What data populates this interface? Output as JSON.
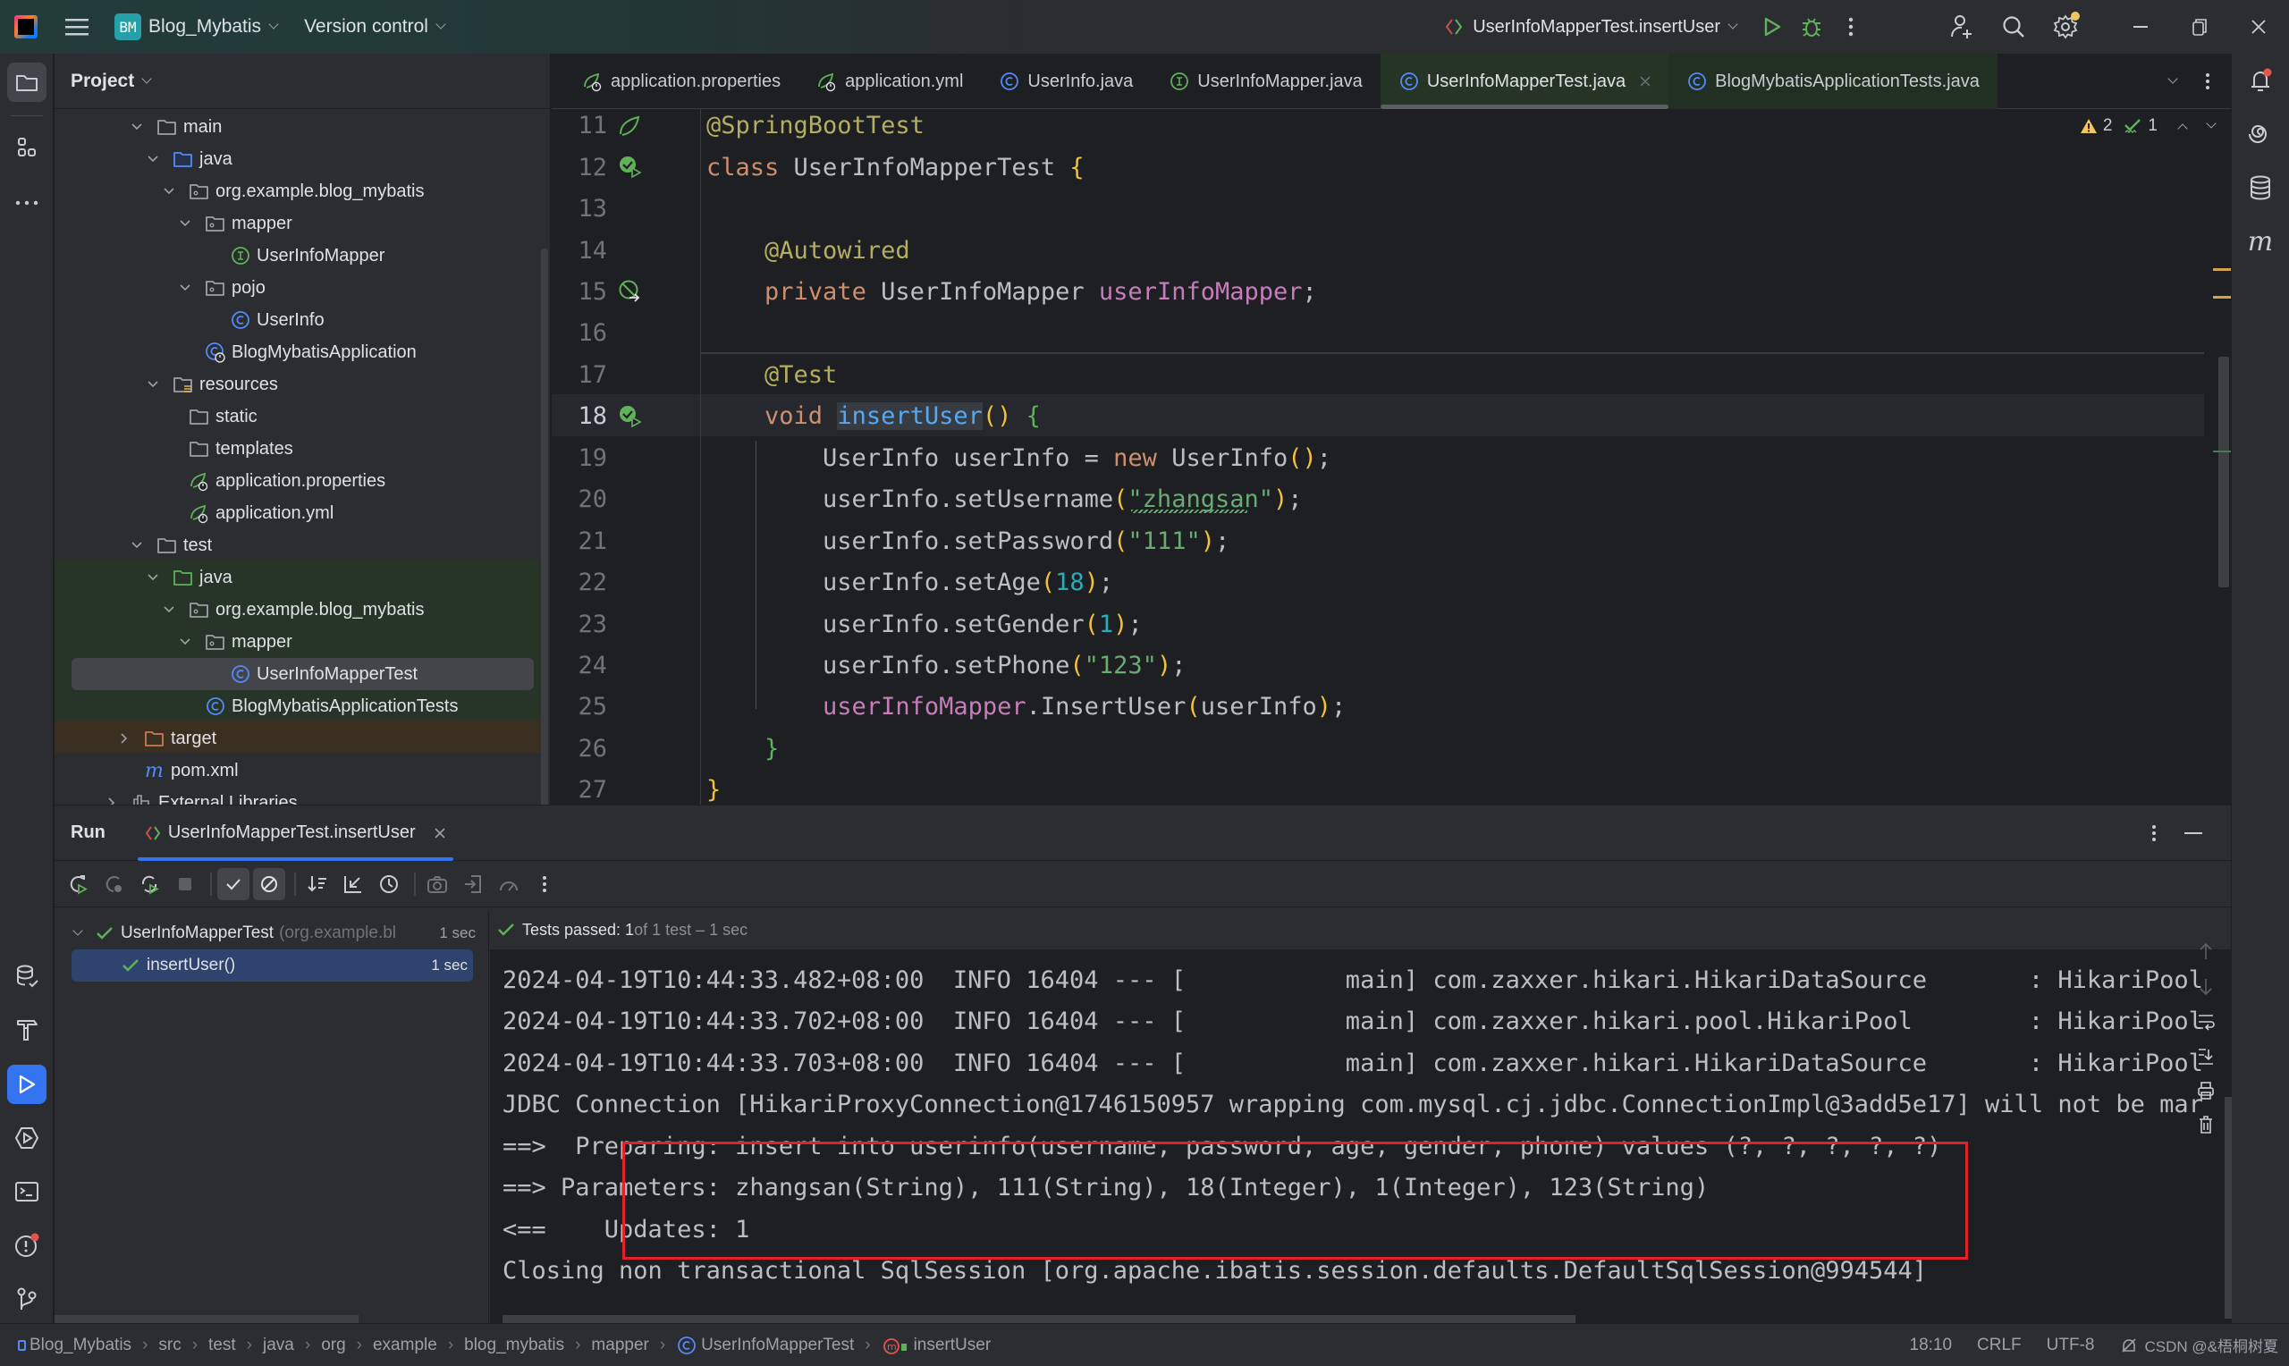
{
  "titlebar": {
    "project_badge": "BM",
    "project_name": "Blog_Mybatis",
    "vcs_label": "Version control",
    "run_config": "UserInfoMapperTest.insertUser"
  },
  "project_panel": {
    "title": "Project",
    "tree": [
      {
        "label": "main",
        "icon": "folder-icon",
        "depth": 0,
        "expanded": true
      },
      {
        "label": "java",
        "icon": "source-folder-icon",
        "depth": 1,
        "expanded": true
      },
      {
        "label": "org.example.blog_mybatis",
        "icon": "package-icon",
        "depth": 2,
        "expanded": true
      },
      {
        "label": "mapper",
        "icon": "package-icon",
        "depth": 3,
        "expanded": true
      },
      {
        "label": "UserInfoMapper",
        "icon": "interface-icon",
        "depth": 4
      },
      {
        "label": "pojo",
        "icon": "package-icon",
        "depth": 3,
        "expanded": true
      },
      {
        "label": "UserInfo",
        "icon": "class-icon",
        "depth": 4
      },
      {
        "label": "BlogMybatisApplication",
        "icon": "spring-boot-class-icon",
        "depth": 3
      },
      {
        "label": "resources",
        "icon": "resources-folder-icon",
        "depth": 1,
        "expanded": true
      },
      {
        "label": "static",
        "icon": "folder-icon",
        "depth": 2
      },
      {
        "label": "templates",
        "icon": "folder-icon",
        "depth": 2
      },
      {
        "label": "application.properties",
        "icon": "spring-config-icon",
        "depth": 2
      },
      {
        "label": "application.yml",
        "icon": "spring-config-icon",
        "depth": 2
      },
      {
        "label": "test",
        "icon": "folder-icon",
        "depth": 0,
        "expanded": true
      },
      {
        "label": "java",
        "icon": "test-folder-icon",
        "depth": 1,
        "expanded": true
      },
      {
        "label": "org.example.blog_mybatis",
        "icon": "package-icon",
        "depth": 2,
        "expanded": true
      },
      {
        "label": "mapper",
        "icon": "package-icon",
        "depth": 3,
        "expanded": true
      },
      {
        "label": "UserInfoMapperTest",
        "icon": "class-icon",
        "depth": 4,
        "selected": true
      },
      {
        "label": "BlogMybatisApplicationTests",
        "icon": "class-icon",
        "depth": 3
      },
      {
        "label": "target",
        "icon": "excluded-folder-icon",
        "depth": -1,
        "expanded": false
      },
      {
        "label": "pom.xml",
        "icon": "maven-icon",
        "depth": -1
      },
      {
        "label": "External Libraries",
        "icon": "library-icon",
        "depth": -2,
        "expanded": false
      }
    ]
  },
  "tabs": [
    {
      "label": "application.properties",
      "icon": "spring-config-icon"
    },
    {
      "label": "application.yml",
      "icon": "spring-config-icon"
    },
    {
      "label": "UserInfo.java",
      "icon": "class-icon"
    },
    {
      "label": "UserInfoMapper.java",
      "icon": "interface-icon"
    },
    {
      "label": "UserInfoMapperTest.java",
      "icon": "class-icon",
      "active": true
    },
    {
      "label": "BlogMybatisApplicationTests.java",
      "icon": "class-icon"
    }
  ],
  "editor": {
    "warnings": "2",
    "typos": "1",
    "current_line": 18,
    "lines": [
      {
        "n": "11",
        "tokens": [
          [
            "an",
            "@SpringBootTest"
          ]
        ]
      },
      {
        "n": "12",
        "tokens": [
          [
            "k",
            "class "
          ],
          [
            "pl",
            "UserInfoMapperTest "
          ],
          [
            "br",
            "{"
          ]
        ]
      },
      {
        "n": "13",
        "tokens": []
      },
      {
        "n": "14",
        "tokens": [
          [
            "pl",
            "    "
          ],
          [
            "an",
            "@Autowired"
          ]
        ]
      },
      {
        "n": "15",
        "tokens": [
          [
            "pl",
            "    "
          ],
          [
            "k",
            "private "
          ],
          [
            "pl",
            "UserInfoMapper "
          ],
          [
            "fld",
            "userInfoMapper"
          ],
          [
            "pl",
            ";"
          ]
        ]
      },
      {
        "n": "16",
        "tokens": []
      },
      {
        "n": "17",
        "tokens": [
          [
            "pl",
            "    "
          ],
          [
            "an",
            "@Test"
          ]
        ]
      },
      {
        "n": "18",
        "tokens": [
          [
            "pl",
            "    "
          ],
          [
            "k",
            "void "
          ],
          [
            "mth",
            "insertUser"
          ],
          [
            "br",
            "()"
          ],
          [
            "pl",
            " "
          ],
          [
            "bg",
            "{"
          ]
        ]
      },
      {
        "n": "19",
        "tokens": [
          [
            "pl",
            "        UserInfo userInfo = "
          ],
          [
            "k",
            "new "
          ],
          [
            "pl",
            "UserInfo"
          ],
          [
            "br",
            "()"
          ],
          [
            "pl",
            ";"
          ]
        ]
      },
      {
        "n": "20",
        "tokens": [
          [
            "pl",
            "        userInfo.setUsername"
          ],
          [
            "br",
            "("
          ],
          [
            "st",
            "\"zhangsan\""
          ],
          [
            "br",
            ")"
          ],
          [
            "pl",
            ";"
          ]
        ]
      },
      {
        "n": "21",
        "tokens": [
          [
            "pl",
            "        userInfo.setPassword"
          ],
          [
            "br",
            "("
          ],
          [
            "st",
            "\"111\""
          ],
          [
            "br",
            ")"
          ],
          [
            "pl",
            ";"
          ]
        ]
      },
      {
        "n": "22",
        "tokens": [
          [
            "pl",
            "        userInfo.setAge"
          ],
          [
            "br",
            "("
          ],
          [
            "num",
            "18"
          ],
          [
            "br",
            ")"
          ],
          [
            "pl",
            ";"
          ]
        ]
      },
      {
        "n": "23",
        "tokens": [
          [
            "pl",
            "        userInfo.setGender"
          ],
          [
            "br",
            "("
          ],
          [
            "num",
            "1"
          ],
          [
            "br",
            ")"
          ],
          [
            "pl",
            ";"
          ]
        ]
      },
      {
        "n": "24",
        "tokens": [
          [
            "pl",
            "        userInfo.setPhone"
          ],
          [
            "br",
            "("
          ],
          [
            "st",
            "\"123\""
          ],
          [
            "br",
            ")"
          ],
          [
            "pl",
            ";"
          ]
        ]
      },
      {
        "n": "25",
        "tokens": [
          [
            "pl",
            "        "
          ],
          [
            "fld",
            "userInfoMapper"
          ],
          [
            "pl",
            ".InsertUser"
          ],
          [
            "br",
            "("
          ],
          [
            "pl",
            "userInfo"
          ],
          [
            "br",
            ")"
          ],
          [
            "pl",
            ";"
          ]
        ]
      },
      {
        "n": "26",
        "tokens": [
          [
            "pl",
            "    "
          ],
          [
            "bg",
            "}"
          ]
        ]
      },
      {
        "n": "27",
        "tokens": [
          [
            "br",
            "}"
          ]
        ]
      }
    ]
  },
  "run_panel": {
    "title": "Run",
    "tab_label": "UserInfoMapperTest.insertUser",
    "tests": [
      {
        "label": "UserInfoMapperTest",
        "detail": "(org.example.bl",
        "time": "1 sec",
        "status": "passed"
      },
      {
        "label": "insertUser()",
        "time": "1 sec",
        "status": "passed",
        "selected": true
      }
    ],
    "summary_bold": "Tests passed: 1",
    "summary_rest": " of 1 test – 1 sec",
    "console": [
      "2024-04-19T10:44:33.482+08:00  INFO 16404 --- [           main] com.zaxxer.hikari.HikariDataSource       : HikariPool",
      "2024-04-19T10:44:33.702+08:00  INFO 16404 --- [           main] com.zaxxer.hikari.pool.HikariPool        : HikariPool",
      "2024-04-19T10:44:33.703+08:00  INFO 16404 --- [           main] com.zaxxer.hikari.HikariDataSource       : HikariPool",
      "JDBC Connection [HikariProxyConnection@1746150957 wrapping com.mysql.cj.jdbc.ConnectionImpl@3add5e17] will not be mar",
      "==>  Preparing: insert into userinfo(username, password, age, gender, phone) values (?, ?, ?, ?, ?)",
      "==> Parameters: zhangsan(String), 111(String), 18(Integer), 1(Integer), 123(String)",
      "<==    Updates: 1",
      "Closing non transactional SqlSession [org.apache.ibatis.session.defaults.DefaultSqlSession@994544]"
    ]
  },
  "breadcrumb": [
    "Blog_Mybatis",
    "src",
    "test",
    "java",
    "org",
    "example",
    "blog_mybatis",
    "mapper",
    "UserInfoMapperTest",
    "insertUser"
  ],
  "status": {
    "position": "18:10",
    "line_ending": "CRLF",
    "encoding": "UTF-8",
    "watermark": "CSDN @&梧桐树夏"
  },
  "colors": {
    "accent": "#3574f0",
    "pass": "#5fb15a",
    "highlight_box": "#e0232b"
  }
}
